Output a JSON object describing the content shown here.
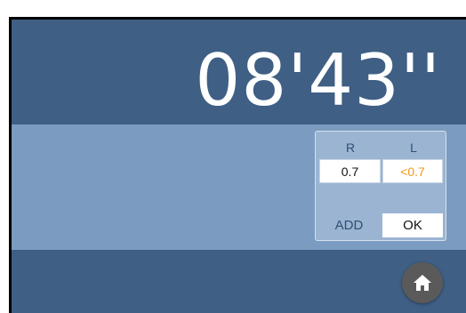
{
  "timer": {
    "display": "08'43''"
  },
  "acuity_panel": {
    "right_header": "R",
    "left_header": "L",
    "right_value": "0.7",
    "left_value": "<0.7",
    "add_label": "ADD",
    "ok_label": "OK"
  },
  "icons": {
    "home": "home-icon"
  },
  "colors": {
    "band_dark": "#3f5f85",
    "band_light": "#7b9bc0",
    "panel": "#9bb4d2",
    "header_text": "#2f4f75",
    "left_value_text": "#f09a1a",
    "home_button": "#5a5a5a"
  }
}
